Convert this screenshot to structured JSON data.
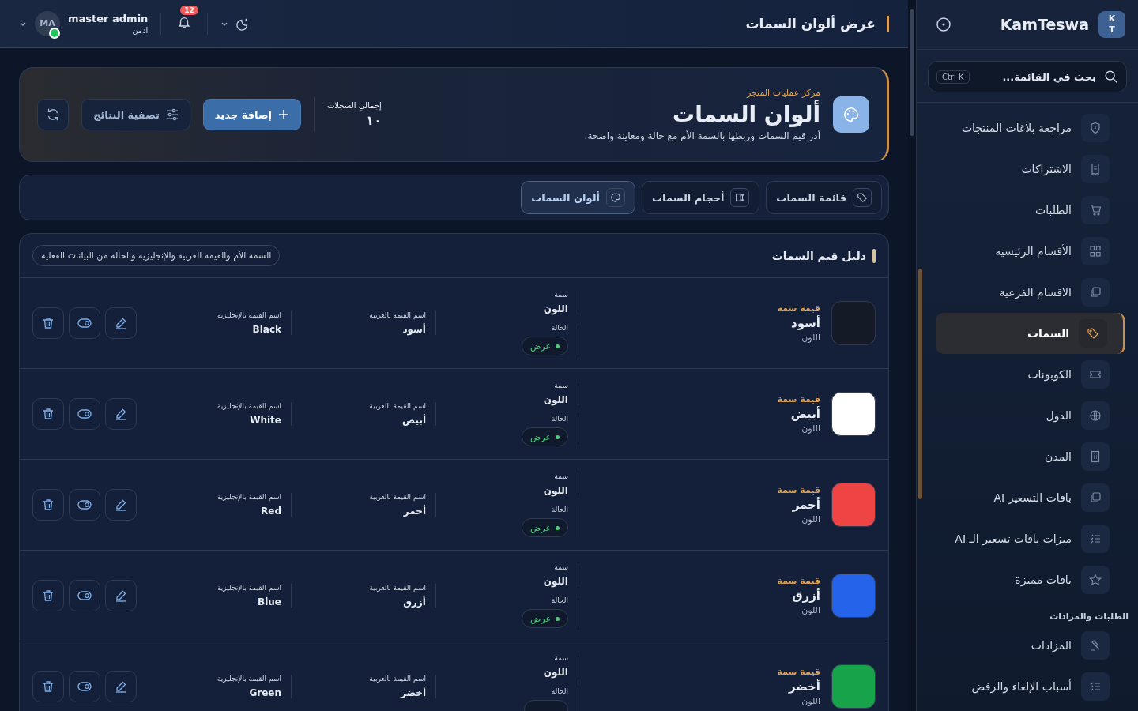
{
  "topbar": {
    "title": "عرض ألوان السمات",
    "user_name": "master admin",
    "user_role": "ادمن",
    "avatar_initials": "MA",
    "online": true,
    "notifications": "12"
  },
  "sidebar": {
    "logo": "K T",
    "brand": "KamTeswa",
    "search_placeholder": "بحث في القائمة...",
    "search_shortcut": "Ctrl K",
    "items": [
      {
        "label": "مراجعة بلاغات المنتجات",
        "selected": false
      },
      {
        "label": "الاشتراكات",
        "selected": false
      },
      {
        "label": "الطلبات",
        "selected": false
      },
      {
        "label": "الأقسام الرئيسية",
        "selected": false
      },
      {
        "label": "الاقسام الفرعية",
        "selected": false
      },
      {
        "label": "السمات",
        "selected": true
      },
      {
        "label": "الكوبونات",
        "selected": false
      },
      {
        "label": "الدول",
        "selected": false
      },
      {
        "label": "المدن",
        "selected": false
      },
      {
        "label": "باقات التسعير AI",
        "selected": false
      },
      {
        "label": "ميزات باقات تسعير الـ AI",
        "selected": false
      },
      {
        "label": "باقات مميزة",
        "selected": false
      }
    ],
    "section_title": "الطلبات والمزادات",
    "section_items": [
      {
        "label": "المزادات",
        "selected": false
      },
      {
        "label": "أسباب الإلغاء والرفض",
        "selected": false
      }
    ]
  },
  "hero": {
    "eyebrow": "مركز عمليات المتجر",
    "title": "ألوان السمات",
    "subtitle": "أدر قيم السمات وربطها بالسمة الأم مع حالة ومعاينة واضحة.",
    "total_label": "إجمالي السجلات",
    "total_value": "١٠",
    "add_button": "إضافة جديد",
    "filter_button": "تصفية النتائج"
  },
  "tabs": [
    {
      "label": "قائمة السمات",
      "selected": false
    },
    {
      "label": "أحجام السمات",
      "selected": false
    },
    {
      "label": "ألوان السمات",
      "selected": true
    }
  ],
  "list": {
    "title": "دليل قيم السمات",
    "note": "السمة الأم والقيمة العربية والإنجليزية والحالة من البيانات الفعلية",
    "rows": [
      {
        "kind_label": "قيمة سمة",
        "name": "أسود",
        "parent_small": "اللون",
        "color": "#151b26",
        "attr_label": "سمة",
        "attr": "اللون",
        "status_label": "الحالة",
        "status": "عرض",
        "active": true,
        "ar_label": "اسم القيمة بالعربية",
        "ar": "أسود",
        "en_label": "اسم القيمة بالإنجليزية",
        "en": "Black"
      },
      {
        "kind_label": "قيمة سمة",
        "name": "أبيض",
        "parent_small": "اللون",
        "color": "#ffffff",
        "attr_label": "سمة",
        "attr": "اللون",
        "status_label": "الحالة",
        "status": "عرض",
        "active": true,
        "ar_label": "اسم القيمة بالعربية",
        "ar": "أبيض",
        "en_label": "اسم القيمة بالإنجليزية",
        "en": "White"
      },
      {
        "kind_label": "قيمة سمة",
        "name": "أحمر",
        "parent_small": "اللون",
        "color": "#ef4444",
        "attr_label": "سمة",
        "attr": "اللون",
        "status_label": "الحالة",
        "status": "عرض",
        "active": true,
        "ar_label": "اسم القيمة بالعربية",
        "ar": "أحمر",
        "en_label": "اسم القيمة بالإنجليزية",
        "en": "Red"
      },
      {
        "kind_label": "قيمة سمة",
        "name": "أزرق",
        "parent_small": "اللون",
        "color": "#2563eb",
        "attr_label": "سمة",
        "attr": "اللون",
        "status_label": "الحالة",
        "status": "عرض",
        "active": true,
        "ar_label": "اسم القيمة بالعربية",
        "ar": "أزرق",
        "en_label": "اسم القيمة بالإنجليزية",
        "en": "Blue"
      },
      {
        "kind_label": "قيمة سمة",
        "name": "أخضر",
        "parent_small": "اللون",
        "color": "#16a34a",
        "attr_label": "سمة",
        "attr": "اللون",
        "status_label": "الحالة",
        "ar_label": "اسم القيمة بالعربية",
        "ar": "أخضر",
        "en_label": "اسم القيمة بالإنجليزية",
        "en": "Green"
      }
    ]
  }
}
